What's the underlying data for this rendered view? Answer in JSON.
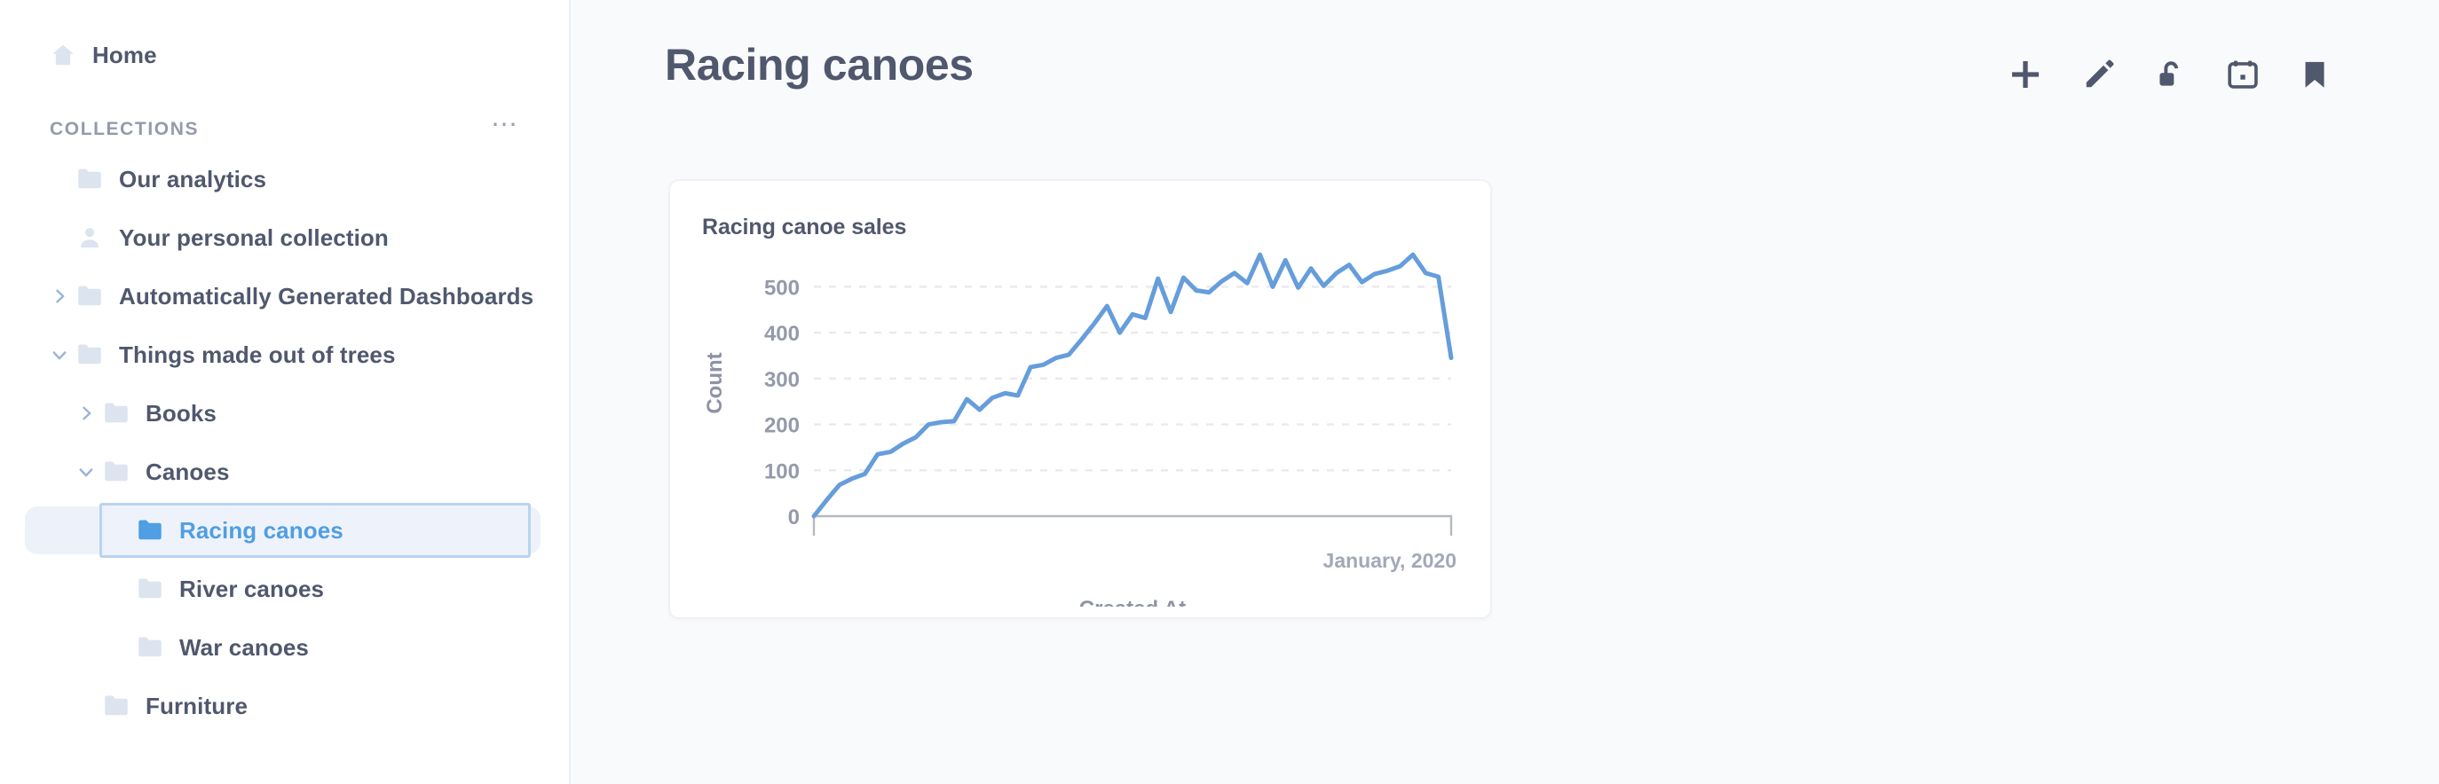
{
  "sidebar": {
    "home": {
      "label": "Home",
      "icon": "home-icon"
    },
    "section": {
      "title": "COLLECTIONS",
      "menu_icon": "ellipsis-icon"
    },
    "items": [
      {
        "label": "Our analytics",
        "icon": "folder-icon",
        "level": 0,
        "chevron": "none",
        "selected": false
      },
      {
        "label": "Your personal collection",
        "icon": "person-icon",
        "level": 0,
        "chevron": "none",
        "selected": false
      },
      {
        "label": "Automatically Generated Dashboards",
        "icon": "folder-icon",
        "level": 0,
        "chevron": "right",
        "selected": false
      },
      {
        "label": "Things made out of trees",
        "icon": "folder-icon",
        "level": 0,
        "chevron": "down",
        "selected": false
      },
      {
        "label": "Books",
        "icon": "folder-icon",
        "level": 1,
        "chevron": "right",
        "selected": false
      },
      {
        "label": "Canoes",
        "icon": "folder-icon",
        "level": 1,
        "chevron": "down",
        "selected": false
      },
      {
        "label": "Racing canoes",
        "icon": "folder-icon",
        "level": 2,
        "chevron": "none",
        "selected": true
      },
      {
        "label": "River canoes",
        "icon": "folder-icon",
        "level": 2,
        "chevron": "none",
        "selected": false
      },
      {
        "label": "War canoes",
        "icon": "folder-icon",
        "level": 2,
        "chevron": "none",
        "selected": false
      },
      {
        "label": "Furniture",
        "icon": "folder-icon",
        "level": 1,
        "chevron": "none",
        "selected": false
      }
    ]
  },
  "header": {
    "title": "Racing canoes",
    "actions": [
      {
        "name": "add-item-button",
        "icon": "plus-icon"
      },
      {
        "name": "edit-button",
        "icon": "pencil-icon"
      },
      {
        "name": "permissions-button",
        "icon": "unlock-icon"
      },
      {
        "name": "events-button",
        "icon": "calendar-icon"
      },
      {
        "name": "bookmark-button",
        "icon": "bookmark-icon"
      }
    ]
  },
  "card": {
    "title": "Racing canoe sales"
  },
  "colors": {
    "accent": "#509ee3",
    "line": "#669ddb",
    "text": "#50586e",
    "muted": "#949aab",
    "folder": "#dce4ef",
    "selected_bg": "#edf2fa",
    "main_bg": "#f9fafb"
  },
  "chart_data": {
    "type": "line",
    "title": "Racing canoe sales",
    "xlabel": "Created At",
    "ylabel": "Count",
    "ylim": [
      0,
      580
    ],
    "yticks": [
      0,
      100,
      200,
      300,
      400,
      500
    ],
    "xticks": [
      "January, 2020"
    ],
    "grid": true,
    "legend": false,
    "series": [
      {
        "name": "Count",
        "values": [
          0,
          35,
          68,
          82,
          92,
          135,
          140,
          158,
          172,
          200,
          205,
          207,
          255,
          232,
          258,
          268,
          263,
          325,
          330,
          345,
          352,
          385,
          420,
          458,
          400,
          440,
          432,
          518,
          445,
          520,
          492,
          488,
          512,
          530,
          508,
          570,
          500,
          558,
          498,
          540,
          502,
          530,
          548,
          510,
          528,
          535,
          545,
          570,
          530,
          522,
          345
        ]
      }
    ]
  }
}
